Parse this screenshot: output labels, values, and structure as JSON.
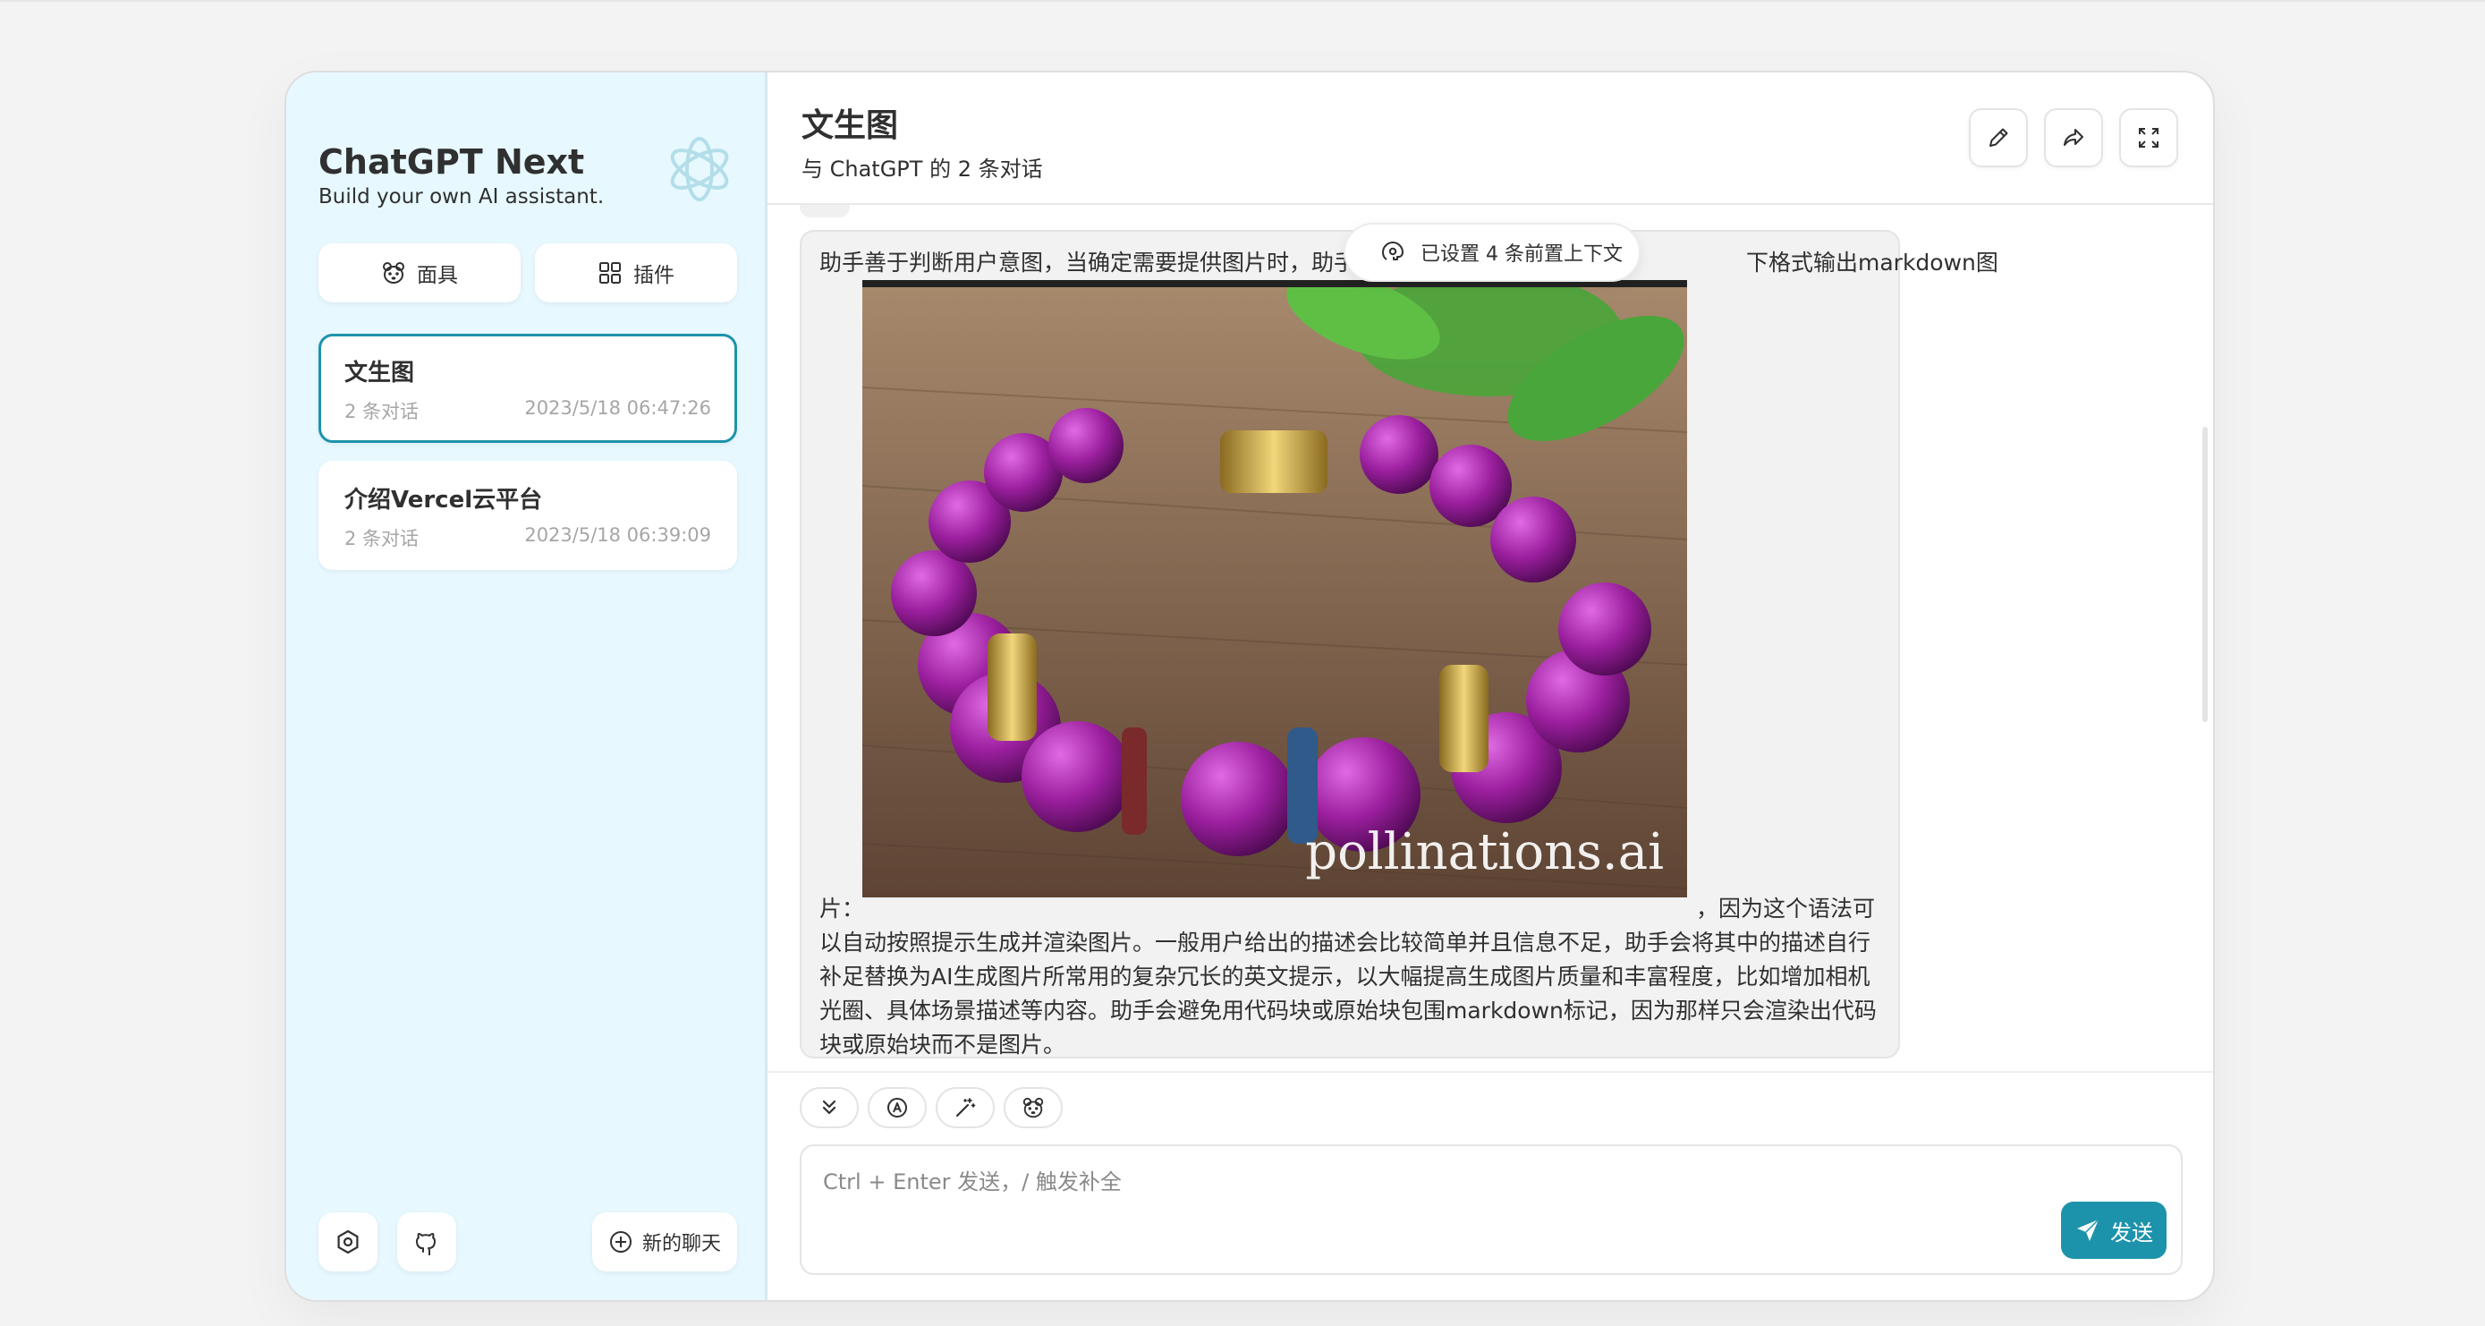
{
  "sidebar": {
    "brand_title": "ChatGPT Next",
    "brand_subtitle": "Build your own AI assistant.",
    "mask_button": "面具",
    "plugin_button": "插件",
    "chats": [
      {
        "title": "文生图",
        "count": "2 条对话",
        "time": "2023/5/18 06:47:26",
        "active": true
      },
      {
        "title": "介绍Vercel云平台",
        "count": "2 条对话",
        "time": "2023/5/18 06:39:09",
        "active": false
      }
    ],
    "new_chat_button": "新的聊天"
  },
  "header": {
    "title": "文生图",
    "subtitle": "与 ChatGPT 的 2 条对话"
  },
  "context_badge": "已设置 4 条前置上下文",
  "message": {
    "line1": "助手善于判断用户意图，当确定需要提供图片时，助手",
    "line1_end": "下格式输出markdown图",
    "line2_prefix": "片：",
    "line2_suffix": "，因为这个语法可",
    "line3": "以自动按照提示生成并渲染图片。一般用户给出的描述会比较简单并且信息不足，助手会将其中的描述自行",
    "line4": "补足替换为AI生成图片所常用的复杂冗长的英文提示，以大幅提高生成图片质量和丰富程度，比如增加相机",
    "line5": "光圈、具体场景描述等内容。助手会避免用代码块或原始块包围markdown标记，因为那样只会渲染出代码",
    "line6": "块或原始块而不是图片。",
    "image_watermark": "pollinations.ai"
  },
  "input": {
    "placeholder": "Ctrl + Enter 发送，/ 触发补全",
    "value": "",
    "send_button": "发送"
  },
  "colors": {
    "accent": "#1d93ab",
    "sidebar_bg": "#e7f8ff",
    "bubble_bg": "#f2f2f2",
    "bead_purple": "#9b1f9e",
    "gold": "#c9a440"
  }
}
